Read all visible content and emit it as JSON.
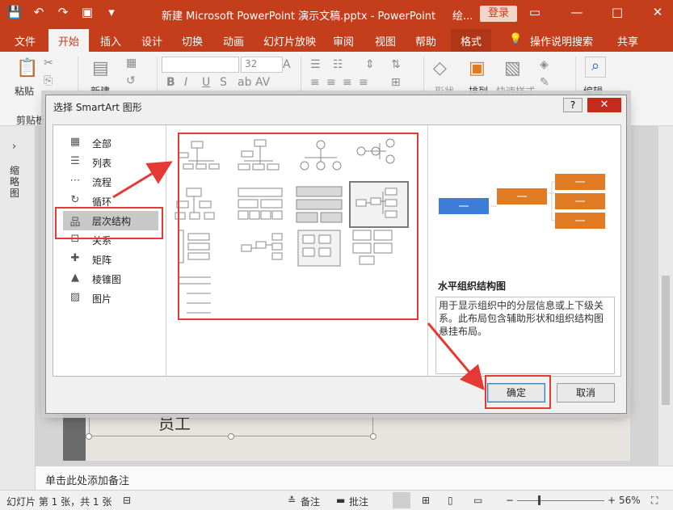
{
  "window": {
    "title": "新建 Microsoft PowerPoint 演示文稿.pptx  -  PowerPoint",
    "search_text": "绘...",
    "login_label": "登录",
    "minimize_icon": "minimize-icon",
    "restore_icon": "restore-icon",
    "close_icon": "close-icon"
  },
  "tabs": [
    {
      "label": "文件"
    },
    {
      "label": "开始"
    },
    {
      "label": "插入"
    },
    {
      "label": "设计"
    },
    {
      "label": "切换"
    },
    {
      "label": "动画"
    },
    {
      "label": "幻灯片放映"
    },
    {
      "label": "审阅"
    },
    {
      "label": "视图"
    },
    {
      "label": "帮助"
    },
    {
      "label": "格式"
    },
    {
      "label": "操作说明搜索"
    },
    {
      "label": "共享"
    }
  ],
  "ribbon": {
    "paste_label": "粘贴",
    "clipboard_group": "剪贴板",
    "new_slide_label": "新建",
    "font_size": "32",
    "shape_label": "形状",
    "arrange_label": "排列",
    "quick_style_label": "快速样式",
    "edit_label": "编辑"
  },
  "left_panel": {
    "vertical_label": "缩略图"
  },
  "slide": {
    "text": "员工"
  },
  "notes": {
    "placeholder": "单击此处添加备注"
  },
  "status": {
    "slide_info": "幻灯片 第 1 张，共 1 张",
    "notes_label": "备注",
    "comments_label": "批注",
    "zoom": "56%"
  },
  "dialog": {
    "title": "选择 SmartArt 图形",
    "help_label": "?",
    "close_label": "✕",
    "categories": [
      {
        "icon": "grid-icon",
        "label": "全部"
      },
      {
        "icon": "list-icon",
        "label": "列表"
      },
      {
        "icon": "process-icon",
        "label": "流程"
      },
      {
        "icon": "cycle-icon",
        "label": "循环"
      },
      {
        "icon": "hierarchy-icon",
        "label": "层次结构"
      },
      {
        "icon": "relationship-icon",
        "label": "关系"
      },
      {
        "icon": "matrix-icon",
        "label": "矩阵"
      },
      {
        "icon": "pyramid-icon",
        "label": "棱锥图"
      },
      {
        "icon": "picture-icon",
        "label": "图片"
      }
    ],
    "selected_category": "层次结构",
    "preview_title": "水平组织结构图",
    "preview_desc": "用于显示组织中的分层信息或上下级关系。此布局包含辅助形状和组织结构图悬挂布局。",
    "ok_label": "确定",
    "cancel_label": "取消",
    "colors": {
      "blue": "#3b7dd8",
      "orange": "#e07a23",
      "highlight": "#e53935"
    }
  }
}
